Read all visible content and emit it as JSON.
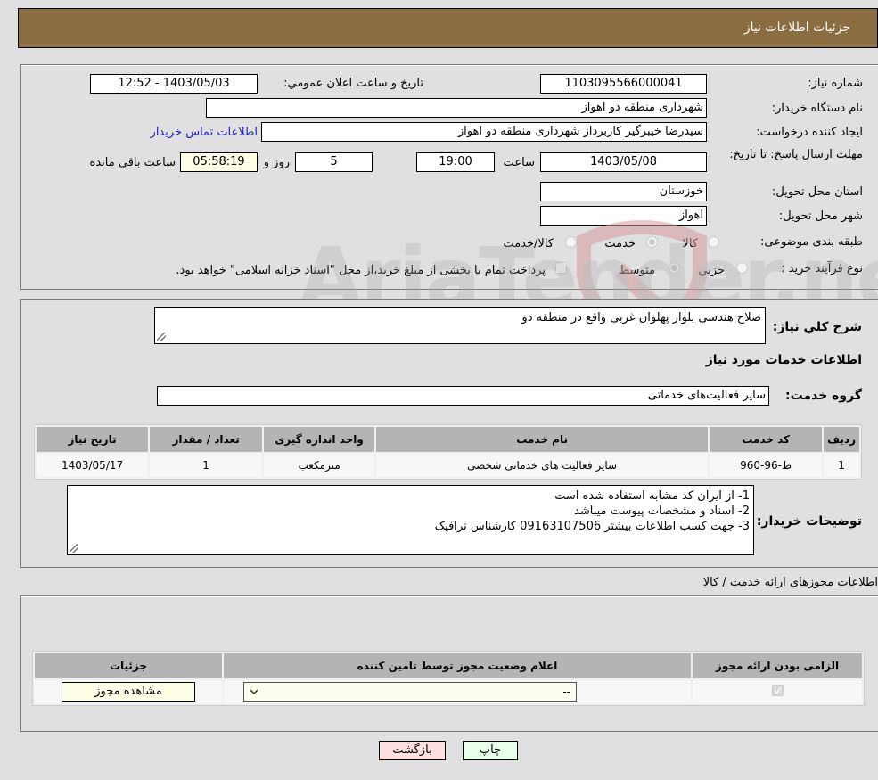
{
  "header": {
    "title": "جزئیات اطلاعات نیاز"
  },
  "info": {
    "need_number_label": "شماره نیاز:",
    "need_number": "1103095566000041",
    "announce_label": "تاریخ و ساعت اعلان عمومي:",
    "announce_value": "1403/05/03 - 12:52",
    "buyer_org_label": "نام دستگاه خريدار:",
    "buyer_org": "شهرداری منطقه دو اهواز",
    "creator_label": "ایجاد کننده درخواست:",
    "creator": "سیدرضا خیبرگیر کاربرداز  شهرداری منطقه دو اهواز",
    "contact_link": "اطلاعات تماس خریدار",
    "deadline_label": "مهلت ارسال پاسخ: تا تاریخ:",
    "deadline_date": "1403/05/08",
    "time_label": "ساعت",
    "deadline_time": "19:00",
    "days_value": "5",
    "days_label": "روز و",
    "remaining_time": "05:58:19",
    "remaining_label": "ساعت باقي مانده",
    "province_label": "استان محل تحویل:",
    "province": "خوزستان",
    "city_label": "شهر محل تحویل:",
    "city": "اهواز",
    "category_label": "طبقه بندی موضوعی:",
    "category_options": [
      {
        "label": "کالا",
        "selected": false
      },
      {
        "label": "خدمت",
        "selected": true
      },
      {
        "label": "کالا/خدمت",
        "selected": false
      }
    ],
    "process_label": "نوع فرآیند خرید :",
    "process_options": [
      {
        "label": "جزيي",
        "selected": false
      },
      {
        "label": "متوسط",
        "selected": true
      }
    ],
    "treasury_note": "پرداخت تمام یا بخشی از مبلغ خرید،از محل \"اسناد خزانه اسلامی\" خواهد بود."
  },
  "details": {
    "summary_label": "شرح کلي نیاز:",
    "summary": "صلاح هندسی بلوار پهلوان غربی واقع در منطقه دو",
    "services_title": "اطلاعات خدمات مورد نیاز",
    "service_group_label": "گروه خدمت:",
    "service_group": "سایر فعالیت‌های خدماتی",
    "table": {
      "headers": [
        "ردیف",
        "کد خدمت",
        "نام خدمت",
        "واحد اندازه گیری",
        "تعداد / مقدار",
        "تاریخ نیاز"
      ],
      "rows": [
        [
          "1",
          "ط-96-960",
          "سایر فعالیت های خدماتی شخصی",
          "مترمکعب",
          "1",
          "1403/05/17"
        ]
      ]
    },
    "buyer_notes_label": "توضیحات خریدار:",
    "buyer_notes": [
      "1- از ایران کد مشابه استفاده شده است",
      "2- اسناد و مشخصات پیوست میباشد",
      "3- جهت کسب اطلاعات بیشتر 09163107506 کارشناس ترافیک"
    ]
  },
  "permits": {
    "title": "اطلاعات مجوزهای ارائه خدمت / کالا",
    "headers": [
      "الزامی بودن ارائه مجوز",
      "اعلام وضعیت مجوز توسط تامین کننده",
      "جزئیات"
    ],
    "row": {
      "required_checked": true,
      "status_value": "--",
      "view_button": "مشاهده مجوز"
    }
  },
  "footer": {
    "print_button": "چاپ",
    "back_button": "بازگشت"
  },
  "watermark": {
    "text": "AriaTender.neT"
  }
}
